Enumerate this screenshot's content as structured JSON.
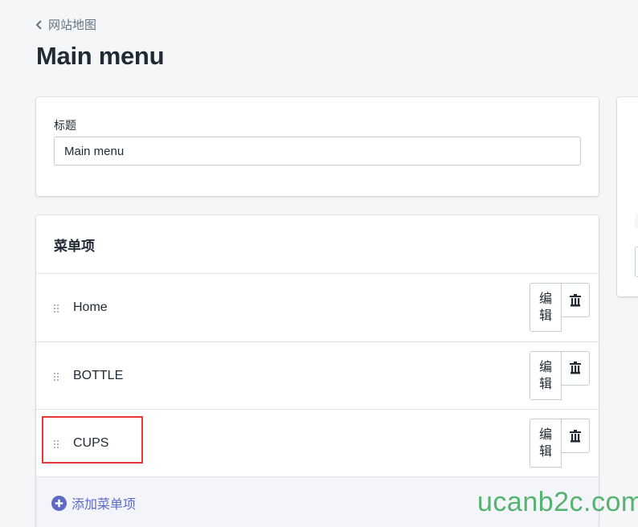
{
  "breadcrumb": {
    "label": "网站地图",
    "icon": "chevron-left-icon"
  },
  "page_title": "Main menu",
  "title_card": {
    "label": "标题",
    "value": "Main menu"
  },
  "menu_card": {
    "heading": "菜单项",
    "items": [
      {
        "label": "Home",
        "edit_label": "编辑"
      },
      {
        "label": "BOTTLE",
        "edit_label": "编辑"
      },
      {
        "label": "CUPS",
        "edit_label": "编辑",
        "highlighted": true
      }
    ],
    "add_label": "添加菜单项"
  },
  "colors": {
    "accent": "#5c6ac4",
    "highlight": "#e53935",
    "watermark": "#3aa858"
  },
  "watermark": "ucanb2c.com"
}
